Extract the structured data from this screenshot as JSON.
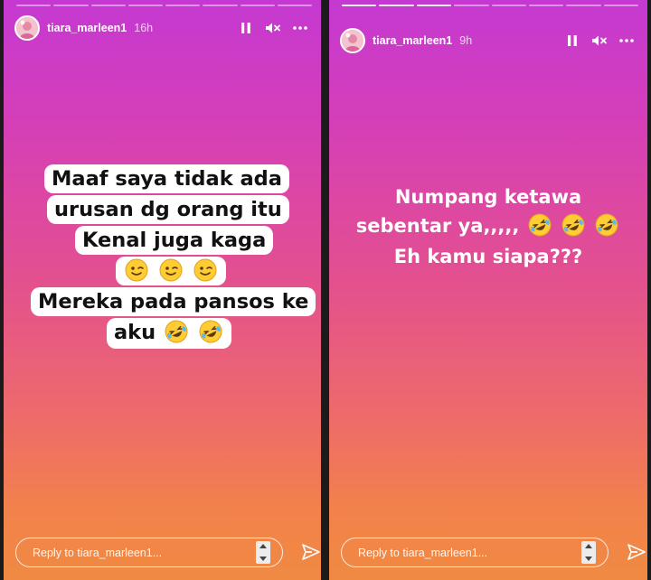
{
  "colors": {
    "gradient_top": "#c539d2",
    "gradient_mid": "#e3508f",
    "gradient_bottom": "#f08a42",
    "sticker_bg": "#ffffff",
    "text_dark": "#111111",
    "text_light": "#ffffff"
  },
  "stories": [
    {
      "username": "tiara_marleen1",
      "time": "16h",
      "progress_segments": 8,
      "progress_done": 0,
      "icons": [
        "pause-icon",
        "mute-icon",
        "more-icon"
      ],
      "sticker_lines": [
        {
          "text": "Maaf saya tidak ada",
          "emojis": []
        },
        {
          "text": "urusan dg orang itu",
          "emojis": []
        },
        {
          "text": "Kenal juga kaga",
          "emojis": []
        },
        {
          "text": "",
          "emojis": [
            "winking-face",
            "winking-face",
            "winking-face"
          ]
        },
        {
          "text": "Mereka pada pansos ke",
          "emojis": []
        },
        {
          "text": "aku",
          "emojis": [
            "rolling-laughing-face",
            "rolling-laughing-face"
          ]
        }
      ],
      "reply_placeholder": "Reply to tiara_marleen1..."
    },
    {
      "username": "tiara_marleen1",
      "time": "9h",
      "progress_segments": 8,
      "progress_done": 3,
      "icons": [
        "pause-icon",
        "mute-icon",
        "more-icon"
      ],
      "text_lines": [
        {
          "text": "Numpang ketawa",
          "emojis": []
        },
        {
          "text": "sebentar ya,,,,,",
          "emojis": [
            "rolling-laughing-face",
            "rolling-laughing-face",
            "rolling-laughing-face"
          ]
        },
        {
          "text": "Eh kamu siapa???",
          "emojis": []
        }
      ],
      "reply_placeholder": "Reply to tiara_marleen1..."
    }
  ]
}
